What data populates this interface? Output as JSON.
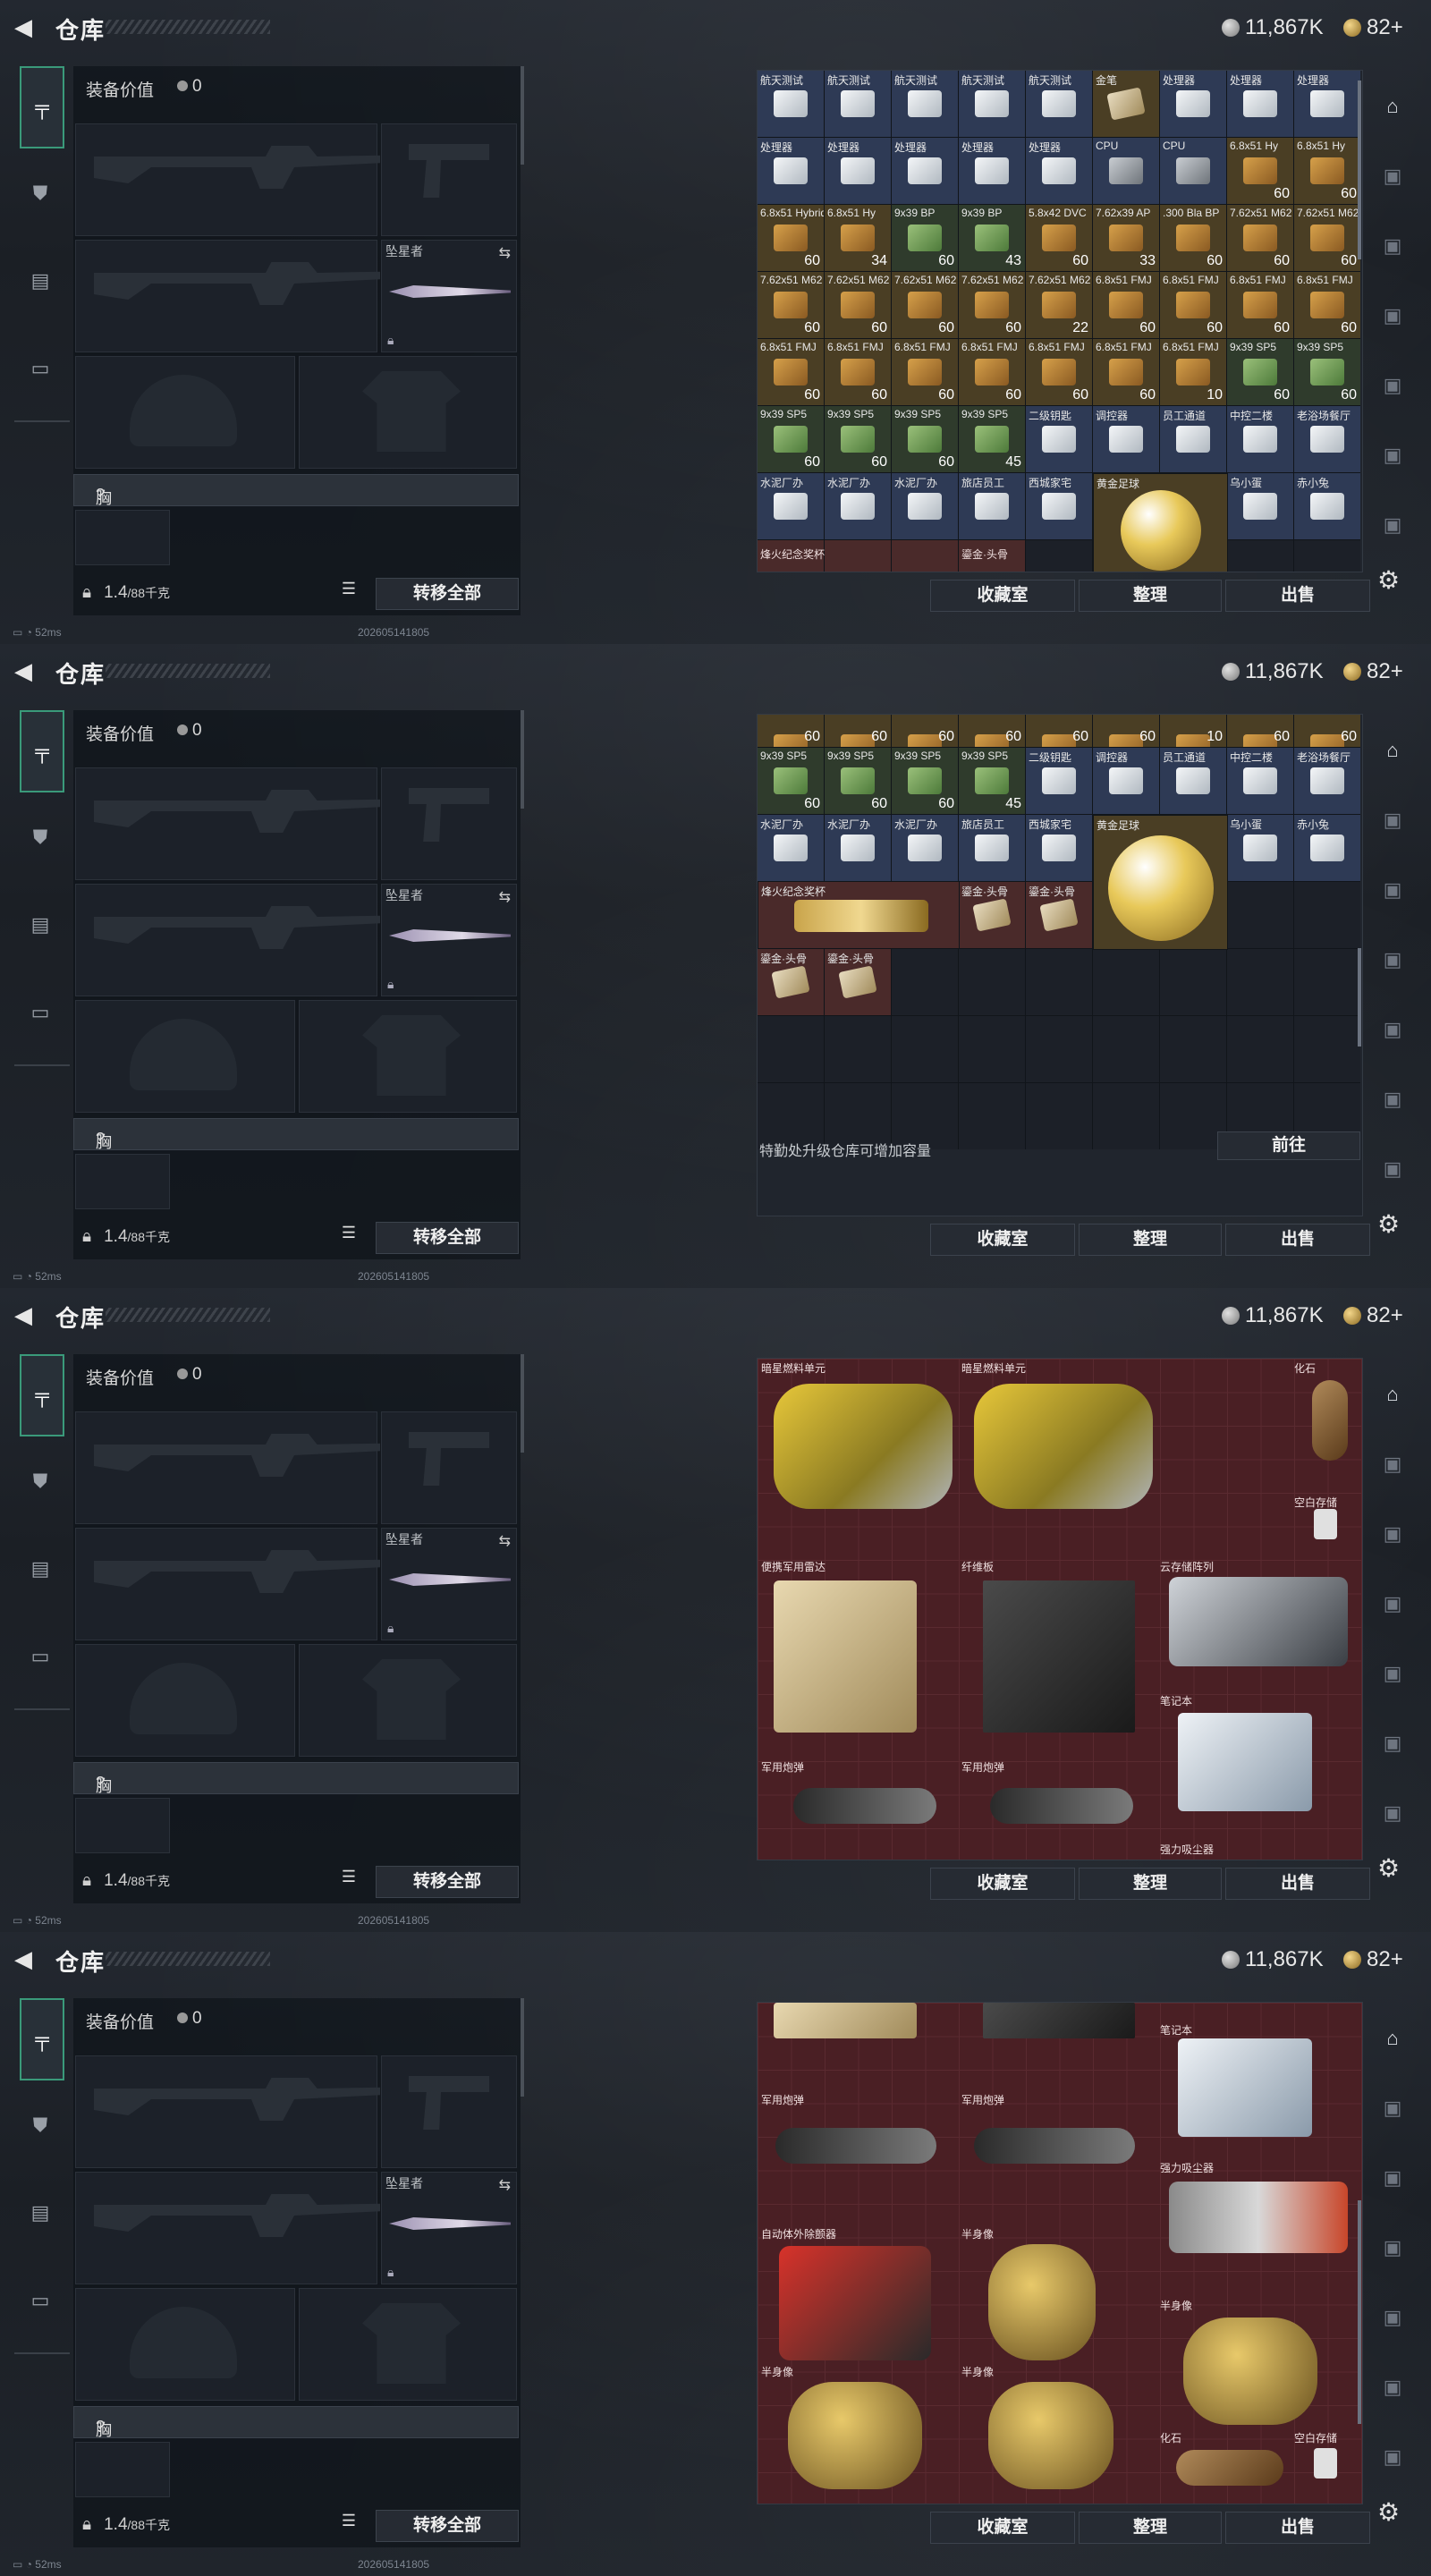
{
  "header": {
    "title": "仓库",
    "silver": "11,867K",
    "gold": "82+"
  },
  "equip": {
    "value_label": "装备价值",
    "value": "0",
    "melee_name": "坠星者",
    "rig_label": "胸挂",
    "rig_hint": "?",
    "weight": "1.4",
    "weight_max": "/88千克",
    "transfer_all": "转移全部"
  },
  "actions": {
    "collection": "收藏室",
    "organize": "整理",
    "sell": "出售"
  },
  "status": {
    "ping": "52ms",
    "build": "202605141805"
  },
  "panel1": {
    "cells": [
      {
        "n": "航天测试",
        "c": "",
        "t": "white"
      },
      {
        "n": "航天测试",
        "c": "",
        "t": "white"
      },
      {
        "n": "航天测试",
        "c": "",
        "t": "white"
      },
      {
        "n": "航天测试",
        "c": "",
        "t": "white"
      },
      {
        "n": "航天测试",
        "c": "",
        "t": "white"
      },
      {
        "n": "金笔",
        "c": "",
        "t": "doc"
      },
      {
        "n": "处理器",
        "c": "",
        "t": "white"
      },
      {
        "n": "处理器",
        "c": "",
        "t": "white"
      },
      {
        "n": "处理器",
        "c": "",
        "t": "white"
      },
      {
        "n": "处理器",
        "c": "",
        "t": "white"
      },
      {
        "n": "处理器",
        "c": "",
        "t": "white"
      },
      {
        "n": "处理器",
        "c": "",
        "t": "white"
      },
      {
        "n": "处理器",
        "c": "",
        "t": "white"
      },
      {
        "n": "处理器",
        "c": "",
        "t": "white"
      },
      {
        "n": "CPU",
        "c": "",
        "t": "cpu"
      },
      {
        "n": "CPU",
        "c": "",
        "t": "cpu"
      },
      {
        "n": "6.8x51 Hy",
        "c": "60",
        "t": "box"
      },
      {
        "n": "6.8x51 Hy",
        "c": "60",
        "t": "box"
      },
      {
        "n": "6.8x51 Hybrid",
        "c": "60",
        "t": "box"
      },
      {
        "n": "6.8x51 Hy",
        "c": "34",
        "t": "box"
      },
      {
        "n": "9x39 BP",
        "c": "60",
        "t": "greenbox"
      },
      {
        "n": "9x39 BP",
        "c": "43",
        "t": "greenbox"
      },
      {
        "n": "5.8x42 DVC",
        "c": "60",
        "t": "box"
      },
      {
        "n": "7.62x39 AP",
        "c": "33",
        "t": "box"
      },
      {
        "n": ".300 Bla BP",
        "c": "60",
        "t": "box"
      },
      {
        "n": "7.62x51 M62",
        "c": "60",
        "t": "box"
      },
      {
        "n": "7.62x51 M62",
        "c": "60",
        "t": "box"
      },
      {
        "n": "7.62x51 M62",
        "c": "60",
        "t": "box"
      },
      {
        "n": "7.62x51 M62",
        "c": "60",
        "t": "box"
      },
      {
        "n": "7.62x51 M62",
        "c": "60",
        "t": "box"
      },
      {
        "n": "7.62x51 M62",
        "c": "60",
        "t": "box"
      },
      {
        "n": "7.62x51 M62",
        "c": "22",
        "t": "box"
      },
      {
        "n": "6.8x51 FMJ",
        "c": "60",
        "t": "box"
      },
      {
        "n": "6.8x51 FMJ",
        "c": "60",
        "t": "box"
      },
      {
        "n": "6.8x51 FMJ",
        "c": "60",
        "t": "box"
      },
      {
        "n": "6.8x51 FMJ",
        "c": "60",
        "t": "box"
      },
      {
        "n": "6.8x51 FMJ",
        "c": "60",
        "t": "box"
      },
      {
        "n": "6.8x51 FMJ",
        "c": "60",
        "t": "box"
      },
      {
        "n": "6.8x51 FMJ",
        "c": "60",
        "t": "box"
      },
      {
        "n": "6.8x51 FMJ",
        "c": "60",
        "t": "box"
      },
      {
        "n": "6.8x51 FMJ",
        "c": "60",
        "t": "box"
      },
      {
        "n": "6.8x51 FMJ",
        "c": "60",
        "t": "box"
      },
      {
        "n": "6.8x51 FMJ",
        "c": "10",
        "t": "box"
      },
      {
        "n": "9x39 SP5",
        "c": "60",
        "t": "greenbox"
      },
      {
        "n": "9x39 SP5",
        "c": "60",
        "t": "greenbox"
      },
      {
        "n": "9x39 SP5",
        "c": "60",
        "t": "greenbox"
      },
      {
        "n": "9x39 SP5",
        "c": "60",
        "t": "greenbox"
      },
      {
        "n": "9x39 SP5",
        "c": "60",
        "t": "greenbox"
      },
      {
        "n": "9x39 SP5",
        "c": "45",
        "t": "greenbox"
      },
      {
        "n": "二级钥匙",
        "c": "",
        "t": "white"
      },
      {
        "n": "调控器",
        "c": "",
        "t": "white"
      },
      {
        "n": "员工通道",
        "c": "",
        "t": "white"
      },
      {
        "n": "中控二楼",
        "c": "",
        "t": "white"
      },
      {
        "n": "老浴场餐厅",
        "c": "",
        "t": "white"
      },
      {
        "n": "水泥厂办",
        "c": "",
        "t": "white"
      },
      {
        "n": "水泥厂办",
        "c": "",
        "t": "white"
      },
      {
        "n": "水泥厂办",
        "c": "",
        "t": "white"
      },
      {
        "n": "旅店员工",
        "c": "",
        "t": "white"
      },
      {
        "n": "西城家宅",
        "c": "",
        "t": "white"
      },
      {
        "n": "",
        "c": "",
        "t": "skip"
      },
      {
        "n": "",
        "c": "",
        "t": "skip"
      },
      {
        "n": "乌小蛋",
        "c": "",
        "t": "white"
      },
      {
        "n": "赤小兔",
        "c": "",
        "t": "white"
      }
    ],
    "ball_label": "黄金足球",
    "partial_label": "烽火纪念奖杯",
    "partial_label2": "鎏金·头骨"
  },
  "panel2": {
    "top_counts": [
      "60",
      "60",
      "60",
      "60",
      "60",
      "60",
      "10",
      "60",
      "60"
    ],
    "cells": [
      {
        "n": "9x39 SP5",
        "c": "60",
        "t": "greenbox"
      },
      {
        "n": "9x39 SP5",
        "c": "60",
        "t": "greenbox"
      },
      {
        "n": "9x39 SP5",
        "c": "60",
        "t": "greenbox"
      },
      {
        "n": "9x39 SP5",
        "c": "45",
        "t": "greenbox"
      },
      {
        "n": "二级钥匙",
        "c": "",
        "t": "white"
      },
      {
        "n": "调控器",
        "c": "",
        "t": "white"
      },
      {
        "n": "员工通道",
        "c": "",
        "t": "white"
      },
      {
        "n": "中控二楼",
        "c": "",
        "t": "white"
      },
      {
        "n": "老浴场餐厅",
        "c": "",
        "t": "white"
      },
      {
        "n": "水泥厂办",
        "c": "",
        "t": "white"
      },
      {
        "n": "水泥厂办",
        "c": "",
        "t": "white"
      },
      {
        "n": "水泥厂办",
        "c": "",
        "t": "white"
      },
      {
        "n": "旅店员工",
        "c": "",
        "t": "white"
      },
      {
        "n": "西城家宅",
        "c": "",
        "t": "white"
      },
      {
        "n": "",
        "c": "",
        "t": "skip"
      },
      {
        "n": "",
        "c": "",
        "t": "skip"
      },
      {
        "n": "乌小蛋",
        "c": "",
        "t": "white"
      },
      {
        "n": "赤小兔",
        "c": "",
        "t": "white"
      }
    ],
    "ball_label": "黄金足球",
    "trophy_label": "烽火纪念奖杯",
    "skull_label": "鎏金·头骨",
    "notice": "特勤处升级仓库可增加容量",
    "goto": "前往"
  },
  "panel3": {
    "items": [
      "暗星燃料单元",
      "暗星燃料单元",
      "化石",
      "空白存储",
      "便携军用雷达",
      "纤维板",
      "云存储阵列",
      "笔记本",
      "军用炮弹",
      "军用炮弹",
      "强力吸尘器"
    ]
  },
  "panel4": {
    "items": [
      "笔记本",
      "军用炮弹",
      "军用炮弹",
      "强力吸尘器",
      "自动体外除颤器",
      "半身像",
      "半身像",
      "半身像",
      "半身像",
      "化石",
      "空白存储"
    ]
  }
}
